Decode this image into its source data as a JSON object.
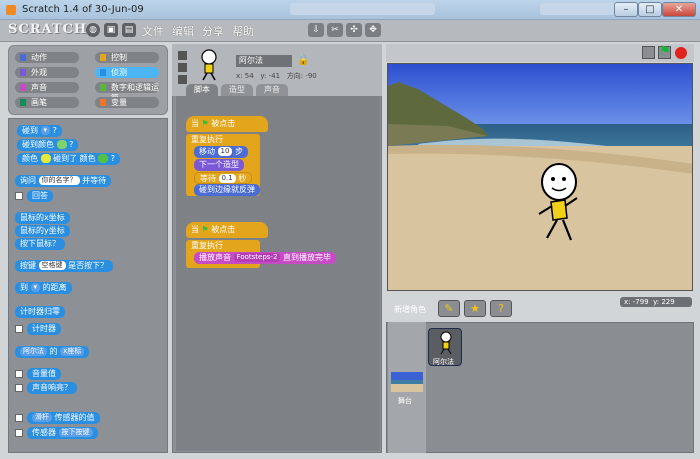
{
  "window": {
    "title": "Scratch 1.4 of 30-Jun-09"
  },
  "menubar": {
    "logo": "SCRATCH",
    "items": [
      "文件",
      "编辑",
      "分享",
      "帮助"
    ]
  },
  "categories": [
    {
      "label": "动作",
      "color": "#4a6cd4"
    },
    {
      "label": "控制",
      "color": "#e3a51b"
    },
    {
      "label": "外观",
      "color": "#7a58d6"
    },
    {
      "label": "侦测",
      "color": "#2a8fe0",
      "selected": true
    },
    {
      "label": "声音",
      "color": "#c64cc5"
    },
    {
      "label": "数字和逻辑运算",
      "color": "#5ab73c"
    },
    {
      "label": "画笔",
      "color": "#0f8e5a"
    },
    {
      "label": "变量",
      "color": "#f2732a"
    }
  ],
  "palette": {
    "touching": "碰到",
    "touching_color": "碰到颜色",
    "color_word": "颜色",
    "touching_color_2": "碰到了",
    "color_word_2": "颜色",
    "ask": "询问",
    "ask_value": "你的名字？",
    "ask_wait": "并等待",
    "answer": "回答",
    "mouse_x": "鼠标的x坐标",
    "mouse_y": "鼠标的y坐标",
    "mouse_down": "按下鼠标？",
    "key": "按键",
    "key_value": "空格键",
    "key_pressed": "是否按下？",
    "distance": "到",
    "distance_suffix": "的距离",
    "timer_reset": "计时器归零",
    "timer": "计时器",
    "attr_of_sprite": "阿尔法",
    "attr_of": "的",
    "attr_x": "x座标",
    "loudness": "音量值",
    "loud": "声音响亮？",
    "sensor_value": "滑杆",
    "sensor_label": "传感器的值",
    "sensor_button": "传感器",
    "sensor_pressed": "按下按键"
  },
  "sprite": {
    "name": "阿尔法",
    "x_label": "x:",
    "x": "54",
    "y_label": "y:",
    "y": "-41",
    "dir_label": "方向:",
    "dir": "-90"
  },
  "tabs": [
    "脚本",
    "造型",
    "声音"
  ],
  "script1": {
    "hat": "当",
    "hat_suffix": "被点击",
    "forever": "重复执行",
    "move": "移动",
    "move_steps": "10",
    "move_unit": "步",
    "next_costume": "下一个造型",
    "wait": "等待",
    "wait_val": "0.1",
    "wait_unit": "秒",
    "bounce": "碰到边缘就反弹"
  },
  "script2": {
    "hat": "当",
    "hat_suffix": "被点击",
    "forever": "重复执行",
    "play": "播放声音",
    "sound": "Footsteps-2",
    "play_until": "直到播放完毕"
  },
  "stage": {
    "coords_x_label": "x:",
    "coords_x": "-799",
    "coords_y_label": "y:",
    "coords_y": "229"
  },
  "new_sprite_label": "新增角色",
  "sprite_list": [
    {
      "name": "阿尔法"
    }
  ],
  "stage_thumb_label": "舞台"
}
